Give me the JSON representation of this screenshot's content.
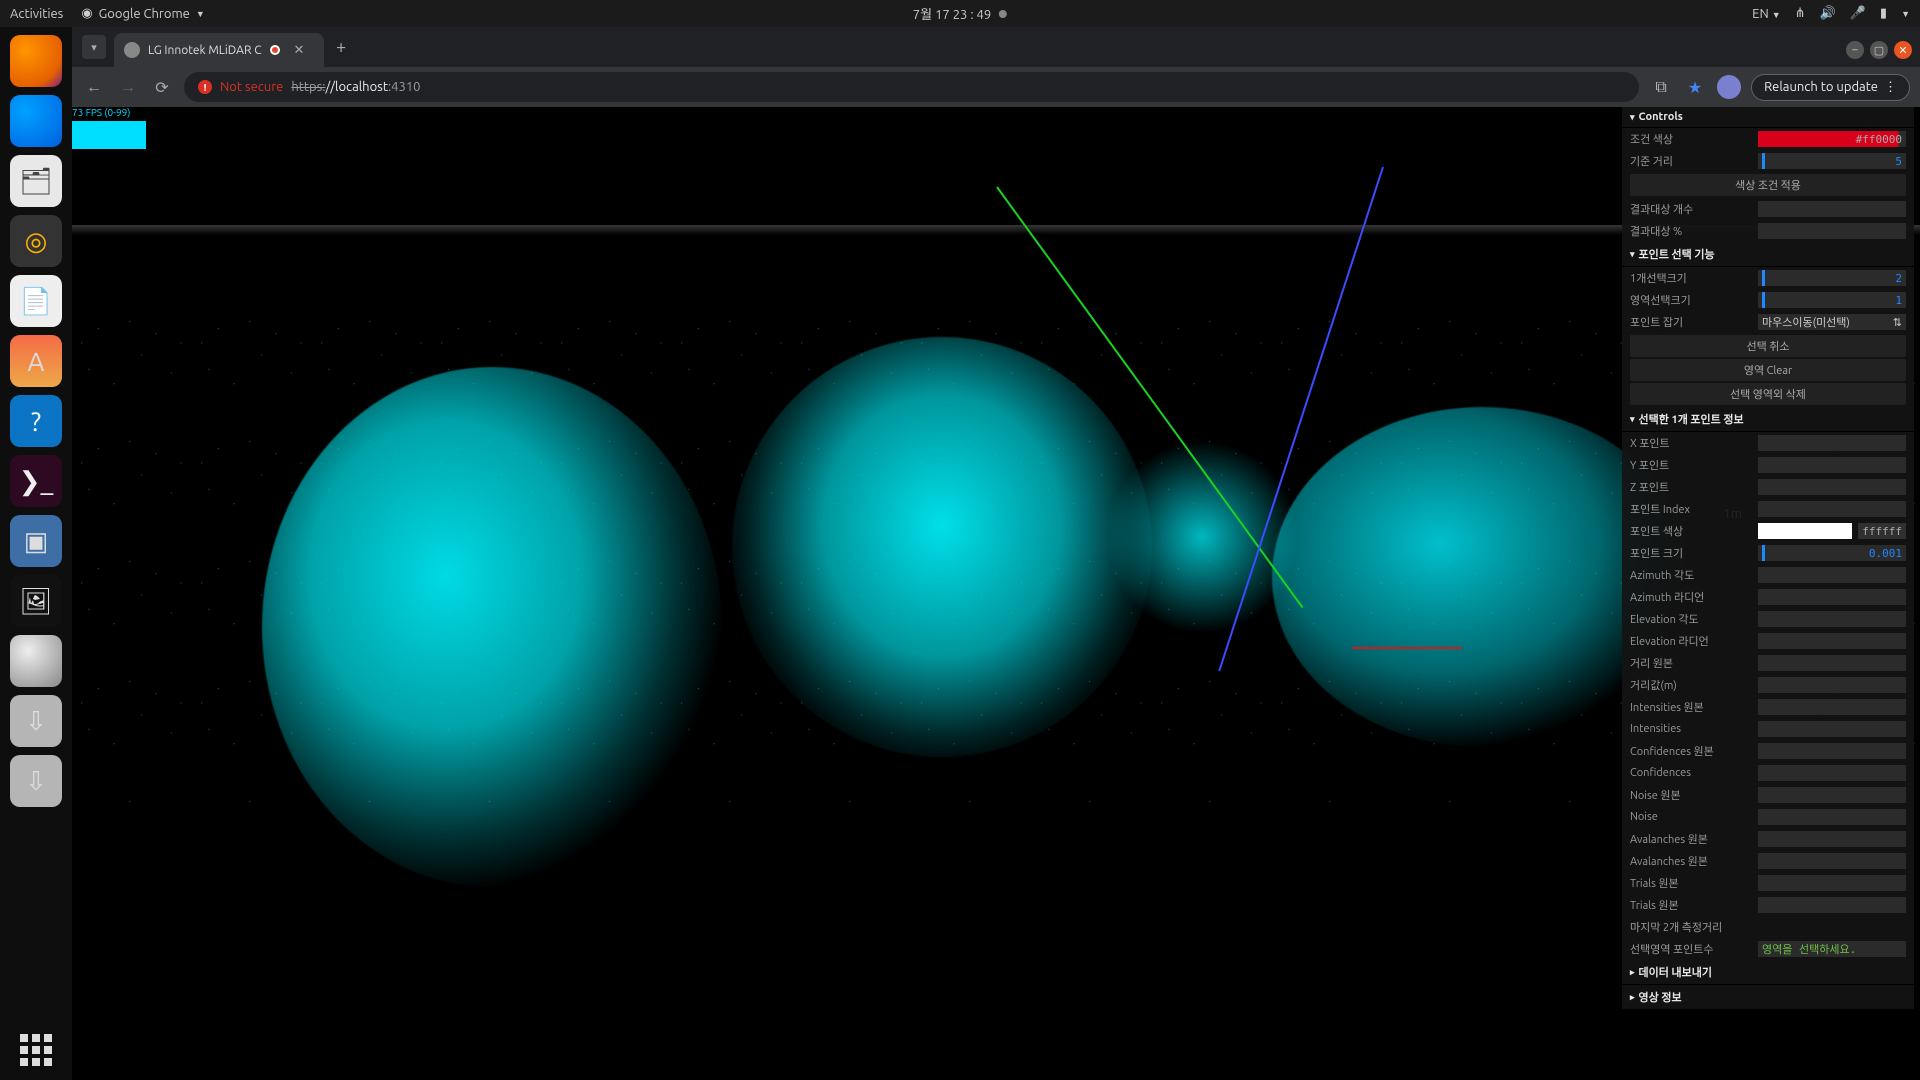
{
  "topbar": {
    "activities": "Activities",
    "app": "Google Chrome",
    "datetime": "7월 17  23 : 49",
    "lang": "EN"
  },
  "tab": {
    "title": "LG Innotek MLiDAR C"
  },
  "toolbar": {
    "notsecure": "Not secure",
    "urlStrike": "https:",
    "urlHost": "//localhost",
    "urlPort": ":4310",
    "relaunch": "Relaunch to update"
  },
  "fps": "73 FPS (0-99)",
  "scale": "1m",
  "gui": {
    "controls": "Controls",
    "row_color": {
      "l": "조건 색상",
      "v": "#ff0000"
    },
    "row_refdist": {
      "l": "기준 거리",
      "v": "5"
    },
    "btn_applyColor": "색상 조건 적용",
    "row_resCount": {
      "l": "결과대상 개수"
    },
    "row_resPct": {
      "l": "결과대상 %"
    },
    "sec_pointsel": "포인트 선택 기능",
    "row_sel1": {
      "l": "1개선택크기",
      "v": "2"
    },
    "row_selArea": {
      "l": "영역선택크기",
      "v": "1"
    },
    "row_grab": {
      "l": "포인트 잡기",
      "v": "마우스이동(미선택)"
    },
    "btn_selCancel": "선택 취소",
    "btn_areaClear": "영역 Clear",
    "btn_delOutside": "선택 영역외 삭제",
    "sec_sel1info": "선택한 1개 포인트 정보",
    "rows_info": [
      "X 포인트",
      "Y 포인트",
      "Z 포인트",
      "포인트 Index"
    ],
    "row_pColor": {
      "l": "포인트 색상",
      "hex": "ffffff"
    },
    "row_pSize": {
      "l": "포인트 크기",
      "v": "0.001"
    },
    "rows_more": [
      "Azimuth 각도",
      "Azimuth 라디언",
      "Elevation 각도",
      "Elevation 라디언",
      "거리 원본",
      "거리값(m)",
      "Intensities 원본",
      "Intensities",
      "Confidences 원본",
      "Confidences",
      "Noise 원본",
      "Noise",
      "Avalanches 원본",
      "Avalanches 원본",
      "Trials 원본",
      "Trials 원본"
    ],
    "row_last2": {
      "l": "마지막 2개 측정거리"
    },
    "row_areaCnt": {
      "l": "선택영역 포인트수",
      "v": "영역을 선택하세요."
    },
    "sec_export": "데이터 내보내기",
    "sec_video": "영상 정보"
  }
}
